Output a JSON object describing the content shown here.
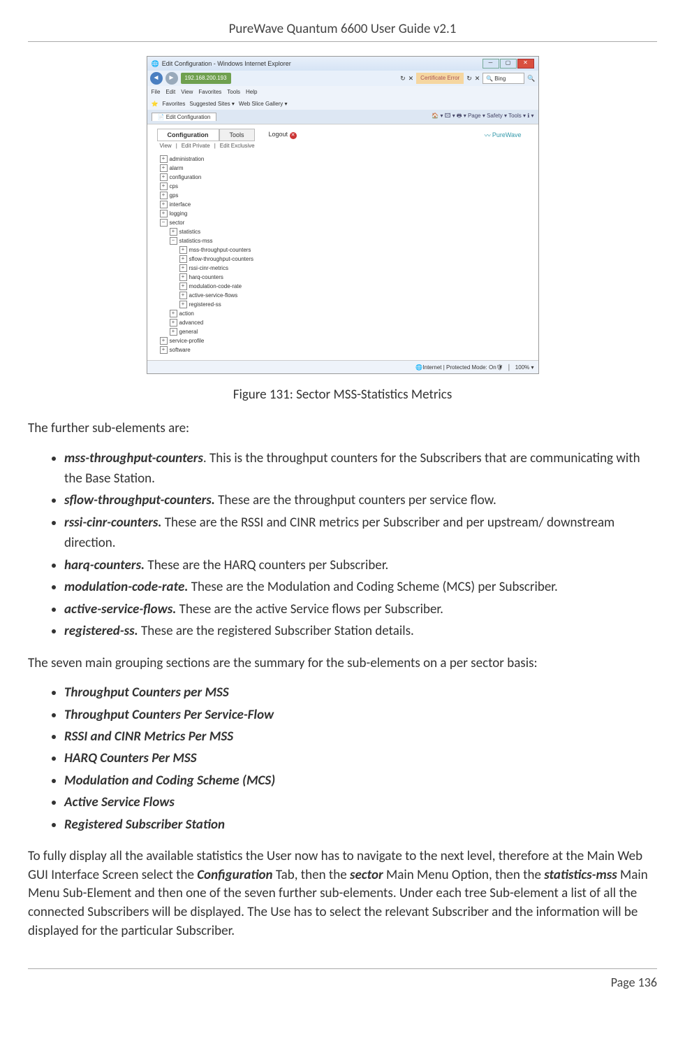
{
  "header": {
    "title": "PureWave Quantum 6600 User Guide v2.1"
  },
  "footer": {
    "page": "Page 136"
  },
  "figure": {
    "caption": "Figure 131: Sector MSS-Statistics Metrics"
  },
  "screenshot": {
    "window_title": "Edit Configuration - Windows Internet Explorer",
    "url_ip": "192.168.200.193",
    "cert_error": "Certificate Error",
    "bing": "Bing",
    "menus": [
      "File",
      "Edit",
      "View",
      "Favorites",
      "Tools",
      "Help"
    ],
    "fav_label": "Favorites",
    "suggested": "Suggested Sites ▾",
    "webslice": "Web Slice Gallery ▾",
    "tab_name": "Edit Configuration",
    "ie_tools": "🏠 ▾ 🖾 ▾ 🖶 ▾ Page ▾ Safety ▾ Tools ▾ ℹ ▾",
    "app_tabs": {
      "config": "Configuration",
      "tools": "Tools"
    },
    "logout": "Logout",
    "brand": "PureWave",
    "sub_tabs": [
      "View",
      "Edit Private",
      "Edit Exclusive"
    ],
    "tree": {
      "administration": "administration",
      "alarm": "alarm",
      "configuration": "configuration",
      "cps": "cps",
      "gps": "gps",
      "interface": "interface",
      "logging": "logging",
      "sector": "sector",
      "statistics": "statistics",
      "statistics_mss": "statistics-mss",
      "mss_throughput": "mss-throughput-counters",
      "sflow_throughput": "sflow-throughput-counters",
      "rssi_cinr": "rssi-cinr-metrics",
      "harq": "harq-counters",
      "mcr": "modulation-code-rate",
      "asf": "active-service-flows",
      "reg_ss": "registered-ss",
      "action": "action",
      "advanced": "advanced",
      "general": "general",
      "service_profile": "service-profile",
      "software": "software"
    },
    "status_left": "Internet | Protected Mode: On",
    "status_zoom": "100% ▾"
  },
  "intro": "The further sub-elements are:",
  "sub_elements": [
    {
      "term": "mss-throughput-counters",
      "suffix": ". This is the throughput counters for the Subscribers that are communicating with the Base Station."
    },
    {
      "term": "sflow-throughput-counters.",
      "suffix": " These are the throughput counters per service flow."
    },
    {
      "term": "rssi-cinr-counters.",
      "suffix": " These are the RSSI and CINR metrics per Subscriber and per upstream/ downstream direction."
    },
    {
      "term": "harq-counters.",
      "suffix": " These are the HARQ counters per Subscriber."
    },
    {
      "term": "modulation-code-rate.",
      "suffix": " These are the Modulation and Coding Scheme (MCS) per Subscriber."
    },
    {
      "term": "active-service-flows.",
      "suffix": " These are the active Service flows per Subscriber."
    },
    {
      "term": "registered-ss.",
      "suffix": " These are the registered Subscriber Station details."
    }
  ],
  "groups_intro": "The seven main grouping sections are the summary for the sub-elements on a per sector basis:",
  "groups": [
    "Throughput Counters per MSS",
    "Throughput Counters Per Service-Flow",
    "RSSI and CINR Metrics Per MSS",
    "HARQ Counters Per MSS",
    "Modulation and Coding Scheme (MCS)",
    "Active Service Flows",
    "Registered Subscriber Station"
  ],
  "closing": {
    "pre": "To fully display all the available statistics the User now has to navigate to the next level, therefore at the Main Web GUI Interface Screen select the ",
    "conf": "Configuration",
    "mid1": " Tab, then the ",
    "sector": "sector",
    "mid2": " Main Menu Option, then the ",
    "stat": "statistics-mss",
    "post": " Main Menu Sub-Element and then one of the seven further sub-elements. Under each tree Sub-element a list of all the connected Subscribers will be displayed. The Use has to select the relevant Subscriber and the information will be displayed for the particular Subscriber."
  }
}
